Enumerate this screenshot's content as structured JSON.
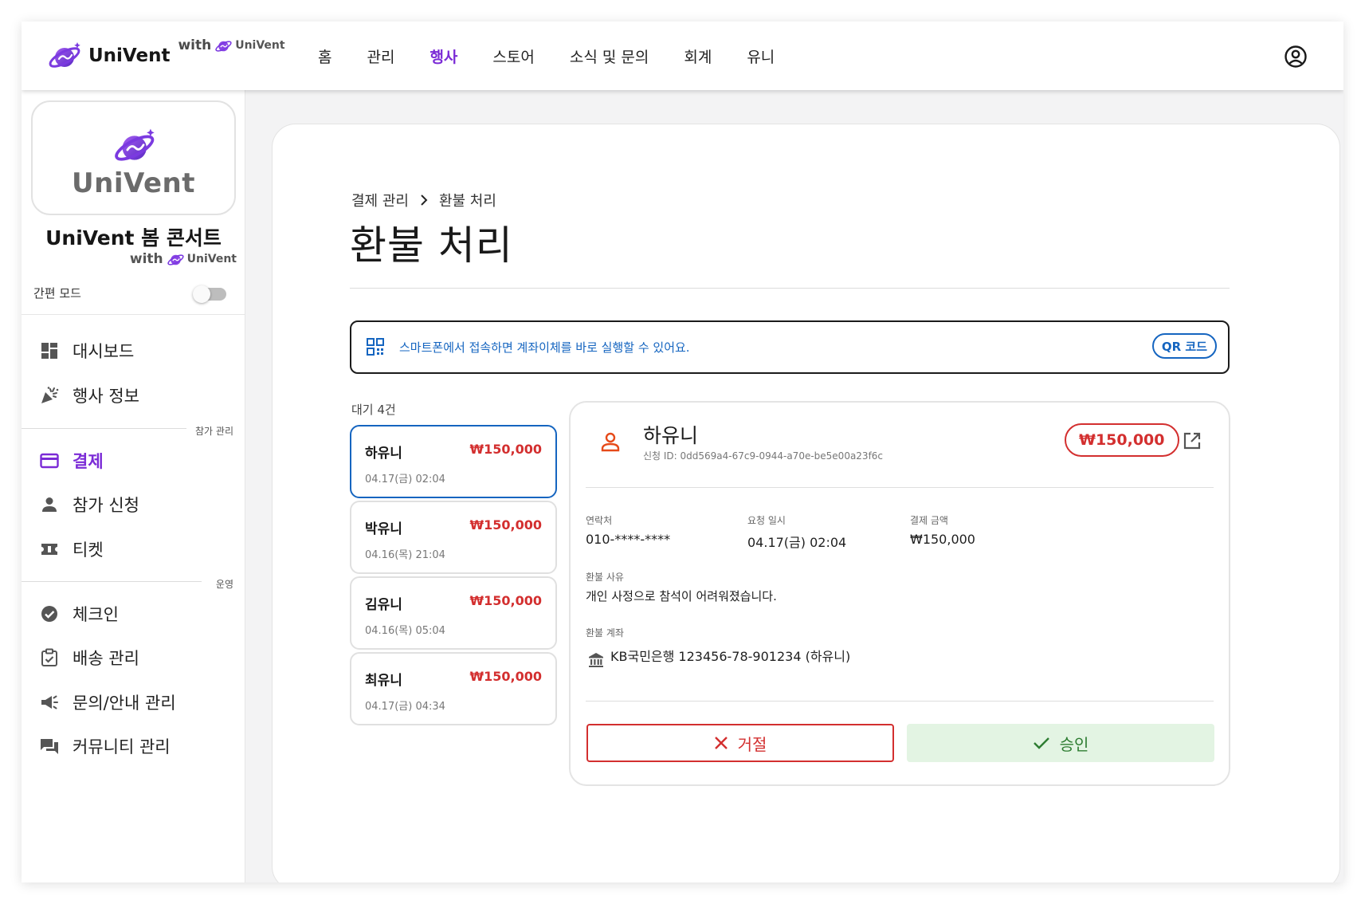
{
  "header": {
    "brand_name": "UniVent",
    "with_text": "with",
    "with_brand": "UniVent",
    "nav": [
      "홈",
      "관리",
      "행사",
      "스토어",
      "소식 및 문의",
      "회계",
      "유니"
    ],
    "active_nav": "행사"
  },
  "sidebar": {
    "logo_text": "UniVent",
    "event_title": "UniVent 봄 콘서트",
    "with_text": "with",
    "with_brand": "UniVent",
    "simple_mode_label": "간편 모드",
    "simple_mode_on": false,
    "items_top": [
      {
        "label": "대시보드",
        "icon": "dashboard-icon"
      },
      {
        "label": "행사 정보",
        "icon": "celebration-icon"
      }
    ],
    "group1_label": "참가 관리",
    "items_group1": [
      {
        "label": "결제",
        "icon": "credit-card-icon",
        "active": true
      },
      {
        "label": "참가 신청",
        "icon": "person-icon"
      },
      {
        "label": "티켓",
        "icon": "ticket-icon"
      }
    ],
    "group2_label": "운영",
    "items_group2": [
      {
        "label": "체크인",
        "icon": "check-circle-icon"
      },
      {
        "label": "배송 관리",
        "icon": "delivery-icon"
      },
      {
        "label": "문의/안내 관리",
        "icon": "campaign-icon"
      },
      {
        "label": "커뮤니티 관리",
        "icon": "forum-icon"
      }
    ]
  },
  "main": {
    "breadcrumb_parent": "결제 관리",
    "breadcrumb_current": "환불 처리",
    "title": "환불 처리",
    "qr_banner_text": "스마트폰에서 접속하면 계좌이체를 바로 실행할 수 있어요.",
    "qr_button_label": "QR 코드",
    "pending_label": "대기 4건",
    "requests": [
      {
        "name": "하유니",
        "amount": "₩150,000",
        "date": "04.17(금) 02:04",
        "selected": true
      },
      {
        "name": "박유니",
        "amount": "₩150,000",
        "date": "04.16(목) 21:04"
      },
      {
        "name": "김유니",
        "amount": "₩150,000",
        "date": "04.16(목) 05:04"
      },
      {
        "name": "최유니",
        "amount": "₩150,000",
        "date": "04.17(금) 04:34"
      }
    ],
    "detail": {
      "name": "하유니",
      "request_id": "신청 ID: 0dd569a4-67c9-0944-a70e-be5e00a23f6c",
      "amount": "₩150,000",
      "contact_label": "연락처",
      "contact_value": "010-****-****",
      "requested_at_label": "요청 일시",
      "requested_at_value": "04.17(금) 02:04",
      "payment_amount_label": "결제 금액",
      "payment_amount_value": "₩150,000",
      "reason_label": "환불 사유",
      "reason_value": "개인 사정으로 참석이 어려워졌습니다.",
      "account_label": "환불 계좌",
      "account_value": "KB국민은행 123456-78-901234 (하유니)",
      "reject_label": "거절",
      "approve_label": "승인"
    }
  },
  "colors": {
    "brand_purple": "#7b2bd6",
    "link_blue": "#1565c0",
    "danger_red": "#d32f2f",
    "success_green": "#2e7d32",
    "success_bg": "#e3f4e3"
  }
}
